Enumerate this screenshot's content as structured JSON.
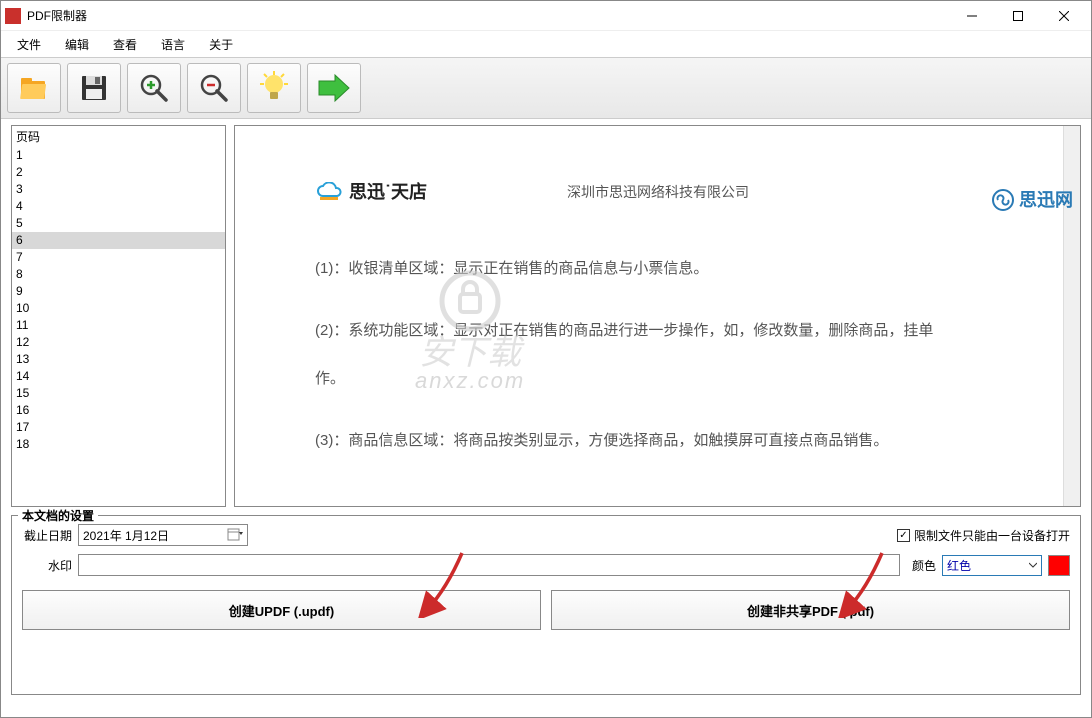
{
  "window": {
    "title": "PDF限制器"
  },
  "menu": {
    "file": "文件",
    "edit": "编辑",
    "view": "查看",
    "language": "语言",
    "about": "关于"
  },
  "toolbar": {
    "open": "open-folder-icon",
    "save": "save-icon",
    "zoom_in": "zoom-in-icon",
    "zoom_out": "zoom-out-icon",
    "lightbulb": "lightbulb-icon",
    "run": "run-arrow-icon"
  },
  "sidebar": {
    "header": "页码",
    "pages": [
      "1",
      "2",
      "3",
      "4",
      "5",
      "6",
      "7",
      "8",
      "9",
      "10",
      "11",
      "12",
      "13",
      "14",
      "15",
      "16",
      "17",
      "18"
    ],
    "selected": "6"
  },
  "document": {
    "logo_text": "思迅˙天店",
    "company": "深圳市思迅网络科技有限公司",
    "right_brand": "思迅网",
    "lines": [
      "(1)：收银清单区域：显示正在销售的商品信息与小票信息。",
      "(2)：系统功能区域：显示对正在销售的商品进行进一步操作，如，修改数量，删除商品，挂单",
      "作。",
      "(3)：商品信息区域：将商品按类别显示，方便选择商品，如触摸屏可直接点商品销售。"
    ],
    "watermark_site": "anxz.com",
    "watermark_label": "安下载"
  },
  "settings": {
    "panel_title": "本文档的设置",
    "expiry_label": "截止日期",
    "expiry_value": "2021年  1月12日",
    "restrict_label": "限制文件只能由一台设备打开",
    "restrict_checked": true,
    "watermark_label": "水印",
    "watermark_value": "",
    "color_label": "颜色",
    "color_value": "红色",
    "color_hex": "#ff0000",
    "create_updf": "创建UPDF (.updf)",
    "create_pdf": "创建非共享PDF (.pdf)"
  }
}
